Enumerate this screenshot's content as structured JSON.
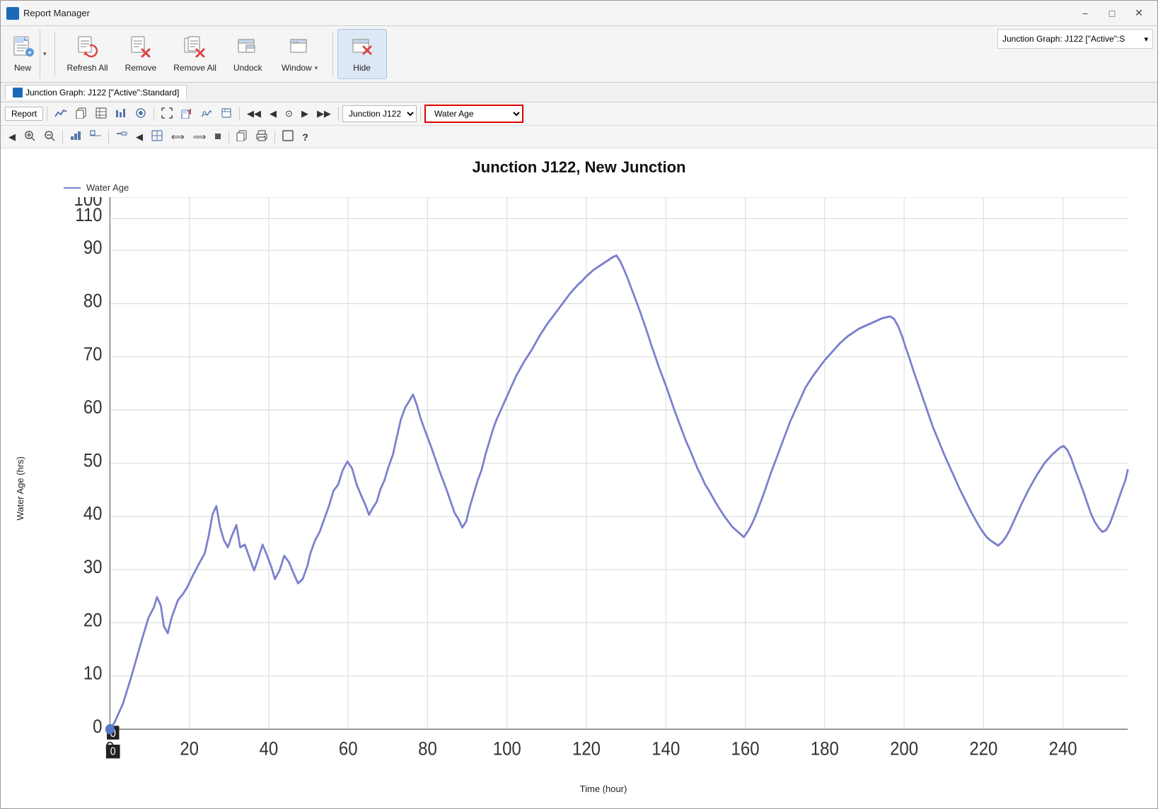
{
  "window": {
    "title": "Report Manager",
    "app_icon_color": "#1a6ab8"
  },
  "title_bar": {
    "title": "Report Manager",
    "minimize_label": "−",
    "maximize_label": "□",
    "close_label": "✕"
  },
  "toolbar": {
    "new_label": "New",
    "refresh_all_label": "Refresh All",
    "remove_label": "Remove",
    "remove_all_label": "Remove All",
    "undock_label": "Undock",
    "window_label": "Window",
    "hide_label": "Hide",
    "report_dropdown_value": "Junction Graph: J122 [\"Active\":S",
    "report_dropdown_arrow": "▾"
  },
  "tab": {
    "label": "Junction Graph: J122 [\"Active\":Standard]"
  },
  "report_toolbar": {
    "report_btn": "Report",
    "junction_select_value": "Junction J122",
    "water_age_select_value": "Water Age",
    "nav_first": "◀◀",
    "nav_prev": "◀",
    "nav_clock": "⊙",
    "nav_next": "▶",
    "nav_last": "▶▶",
    "help": "?"
  },
  "chart": {
    "title": "Junction J122, New Junction",
    "legend_label": "Water Age",
    "y_axis_label": "Water Age (hrs)",
    "x_axis_label": "Time (hour)",
    "y_min": 0,
    "y_max": 110,
    "y_ticks": [
      0,
      10,
      20,
      30,
      40,
      50,
      60,
      70,
      80,
      90,
      100,
      110
    ],
    "x_ticks": [
      0,
      20,
      40,
      60,
      80,
      100,
      120,
      140,
      160,
      180,
      200,
      220,
      240
    ],
    "line_color": "#7b80cc"
  }
}
